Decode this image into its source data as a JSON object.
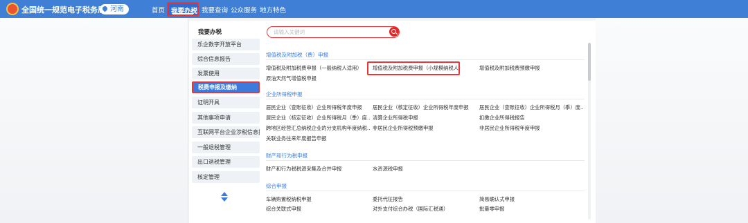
{
  "header": {
    "brand": "全国统一规范电子税务局",
    "region": "河南",
    "nav": [
      "首页",
      "我要办税",
      "我要查询",
      "公众服务",
      "地方特色"
    ],
    "active_nav": "我要办税"
  },
  "sidebar": {
    "title": "我要办税",
    "items": [
      {
        "label": "乐企数字开放平台",
        "active": false
      },
      {
        "label": "综合信息报告",
        "active": false
      },
      {
        "label": "发票使用",
        "active": false
      },
      {
        "label": "税费申报及缴纳",
        "active": true
      },
      {
        "label": "证明开具",
        "active": false
      },
      {
        "label": "其他事项申请",
        "active": false
      },
      {
        "label": "互联网平台企业涉税信息报送",
        "active": false
      },
      {
        "label": "一般退税管理",
        "active": false
      },
      {
        "label": "出口退税管理",
        "active": false
      },
      {
        "label": "核定管理",
        "active": false
      }
    ]
  },
  "search": {
    "placeholder": "请输入关键词"
  },
  "content": {
    "sections": [
      {
        "title": "增值税及附加税（费）申报",
        "items": [
          "增值税及附加税费申报（一般纳税人适用）",
          "增值税及附加税费申报（小规模纳税人）",
          "增值税及附加税费预缴申报",
          "原油天然气增值税申报"
        ]
      },
      {
        "title": "企业所得税申报",
        "items": [
          "居民企业（查账征收）企业所得税年度申报",
          "居民企业（核定征收）企业所得税年度申报",
          "居民企业（查账征收）企业所得税月（季）度...",
          "居民企业（核定征收）企业所得税月（季）度...",
          "清算企业所得税申报",
          "扣缴企业所得税报告",
          "跨地区经营汇总纳税企业的分支机构年度纳税...",
          "非居民企业所得税预缴申报",
          "非居民企业所得税年度申报",
          "关联业务往来年度报告申报"
        ]
      },
      {
        "title": "财产和行为税申报",
        "items": [
          "财产和行为税税源采集及合并申报",
          "水资源税申报"
        ]
      },
      {
        "title": "综合申报",
        "items": [
          "车辆购置税纳税申报",
          "委托代征报告",
          "简易确认式申报",
          "综合关联式申报",
          "对外支付综合办税（国际汇税通）",
          "批量零申报"
        ]
      }
    ]
  },
  "colors": {
    "accent": "#3f7fd6",
    "highlight": "#e83535",
    "category": "#3c7bdb"
  }
}
